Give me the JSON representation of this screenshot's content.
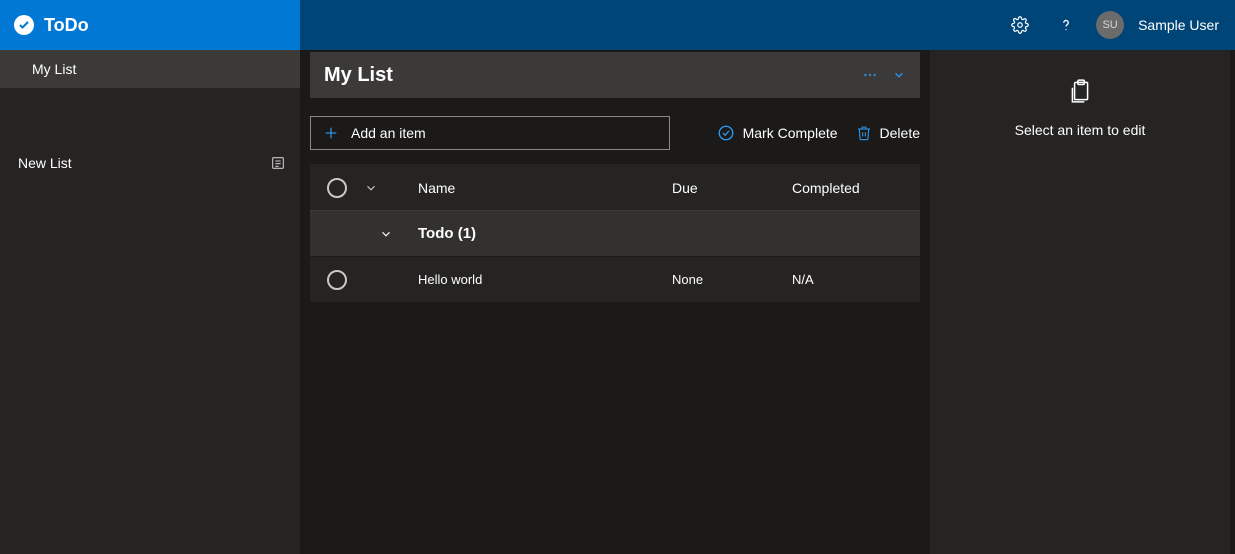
{
  "header": {
    "app_name": "ToDo",
    "user_initials": "SU",
    "user_name": "Sample User"
  },
  "sidebar": {
    "items": [
      {
        "label": "My List",
        "selected": true
      }
    ],
    "new_list_label": "New List"
  },
  "list": {
    "title": "My List",
    "add_label": "Add an item",
    "mark_complete_label": "Mark Complete",
    "delete_label": "Delete",
    "columns": {
      "name": "Name",
      "due": "Due",
      "completed": "Completed"
    },
    "group": {
      "label": "Todo (1)"
    },
    "rows": [
      {
        "name": "Hello world",
        "due": "None",
        "completed": "N/A"
      }
    ]
  },
  "details": {
    "placeholder": "Select an item to edit"
  }
}
